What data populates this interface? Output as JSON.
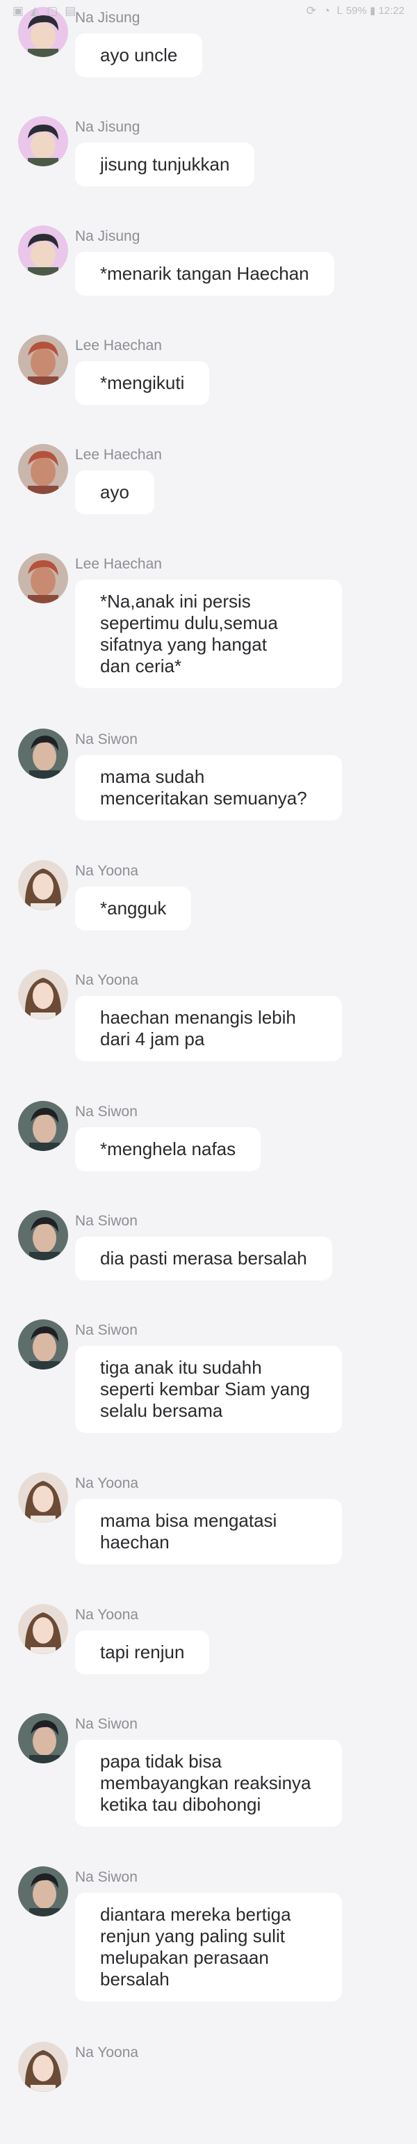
{
  "status_bar": {
    "right_text": "Ꮮ 59% ▮ 12:22"
  },
  "colors": {
    "background": "#f4f4f6",
    "bubble": "#ffffff",
    "name_text": "#8d8d94",
    "message_text": "#2a2a2e"
  },
  "messages": [
    {
      "sender": "Na Jisung",
      "avatar": "jisung-avatar",
      "text": "ayo uncle"
    },
    {
      "sender": "Na Jisung",
      "avatar": "jisung-avatar",
      "text": "jisung tunjukkan"
    },
    {
      "sender": "Na Jisung",
      "avatar": "jisung-avatar",
      "text": "*menarik tangan Haechan"
    },
    {
      "sender": "Lee Haechan",
      "avatar": "haechan-avatar",
      "text": "*mengikuti"
    },
    {
      "sender": "Lee Haechan",
      "avatar": "haechan-avatar",
      "text": "ayo"
    },
    {
      "sender": "Lee Haechan",
      "avatar": "haechan-avatar",
      "text": "*Na,anak ini persis\nsepertimu dulu,semua\nsifatnya yang hangat\ndan ceria*"
    },
    {
      "sender": "Na Siwon",
      "avatar": "siwon-avatar",
      "text": "mama sudah\nmenceritakan semuanya?"
    },
    {
      "sender": "Na Yoona",
      "avatar": "yoona-avatar",
      "text": "*angguk"
    },
    {
      "sender": "Na Yoona",
      "avatar": "yoona-avatar",
      "text": "haechan menangis lebih\ndari 4 jam pa"
    },
    {
      "sender": "Na Siwon",
      "avatar": "siwon-avatar",
      "text": "*menghela nafas"
    },
    {
      "sender": "Na Siwon",
      "avatar": "siwon-avatar",
      "text": "dia pasti merasa bersalah"
    },
    {
      "sender": "Na Siwon",
      "avatar": "siwon-avatar",
      "text": "tiga anak itu sudahh\nseperti kembar Siam yang\nselalu bersama"
    },
    {
      "sender": "Na Yoona",
      "avatar": "yoona-avatar",
      "text": "mama bisa mengatasi\nhaechan"
    },
    {
      "sender": "Na Yoona",
      "avatar": "yoona-avatar",
      "text": "tapi renjun"
    },
    {
      "sender": "Na Siwon",
      "avatar": "siwon-avatar",
      "text": "papa tidak bisa\nmembayangkan reaksinya\nketika tau dibohongi"
    },
    {
      "sender": "Na Siwon",
      "avatar": "siwon-avatar",
      "text": "diantara mereka bertiga\nrenjun yang paling sulit\nmelupakan perasaan\nbersalah"
    },
    {
      "sender": "Na Yoona",
      "avatar": "yoona-avatar",
      "text": ""
    }
  ]
}
